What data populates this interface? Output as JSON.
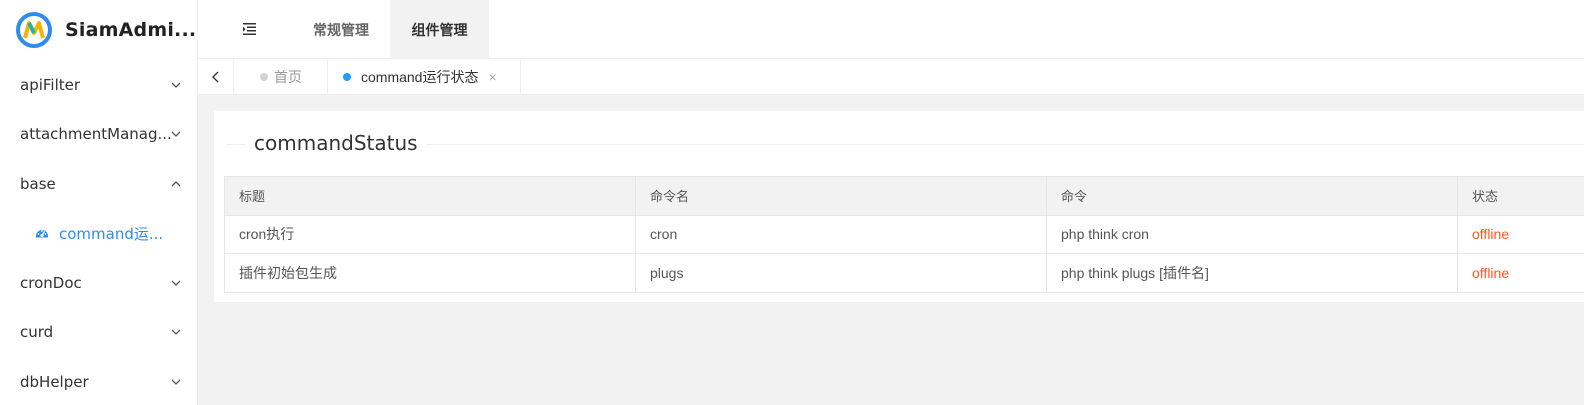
{
  "brand": {
    "name": "SiamAdmi..."
  },
  "sidebar": {
    "items": [
      {
        "label": "apiFilter"
      },
      {
        "label": "attachmentManag..."
      },
      {
        "label": "base"
      },
      {
        "label": "command运..."
      },
      {
        "label": "cronDoc"
      },
      {
        "label": "curd"
      },
      {
        "label": "dbHelper"
      }
    ]
  },
  "header": {
    "tabs": [
      {
        "label": "常规管理"
      },
      {
        "label": "组件管理"
      }
    ]
  },
  "tabbar": {
    "home_label": "首页",
    "active_label": "command运行状态",
    "close_glyph": "×"
  },
  "card": {
    "legend": "commandStatus"
  },
  "table": {
    "headers": [
      "标题",
      "命令名",
      "命令",
      "状态"
    ],
    "rows": [
      {
        "title": "cron执行",
        "name": "cron",
        "command": "php think cron",
        "status": "offline"
      },
      {
        "title": "插件初始包生成",
        "name": "plugs",
        "command": "php think plugs [插件名]",
        "status": "offline"
      }
    ]
  },
  "colors": {
    "accent": "#2d8cf0",
    "offline": "#ff5722",
    "tab_dot": "#1e9fff"
  },
  "icons": {
    "collapse": "menu-fold-icon",
    "prev": "chevron-left-icon",
    "submenu": "dashboard-icon",
    "expand": "chevron-down-icon",
    "collapse_menu": "chevron-up-icon"
  }
}
